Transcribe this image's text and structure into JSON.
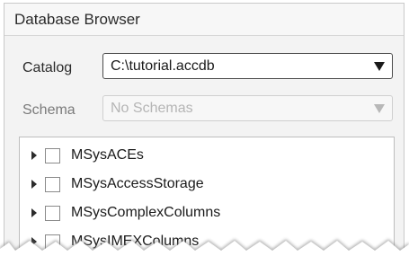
{
  "panel": {
    "title": "Database Browser"
  },
  "catalog": {
    "label": "Catalog",
    "value": "C:\\tutorial.accdb",
    "arrow_icon": "dropdown-arrow-icon"
  },
  "schema": {
    "label": "Schema",
    "value": "No Schemas",
    "enabled": false,
    "arrow_icon": "dropdown-arrow-icon"
  },
  "tables": {
    "items": [
      {
        "label": "MSysACEs",
        "checked": false,
        "expanded": false
      },
      {
        "label": "MSysAccessStorage",
        "checked": false,
        "expanded": false
      },
      {
        "label": "MSysComplexColumns",
        "checked": false,
        "expanded": false
      },
      {
        "label": "MSysIMEXColumns",
        "checked": false,
        "expanded": false
      }
    ]
  }
}
